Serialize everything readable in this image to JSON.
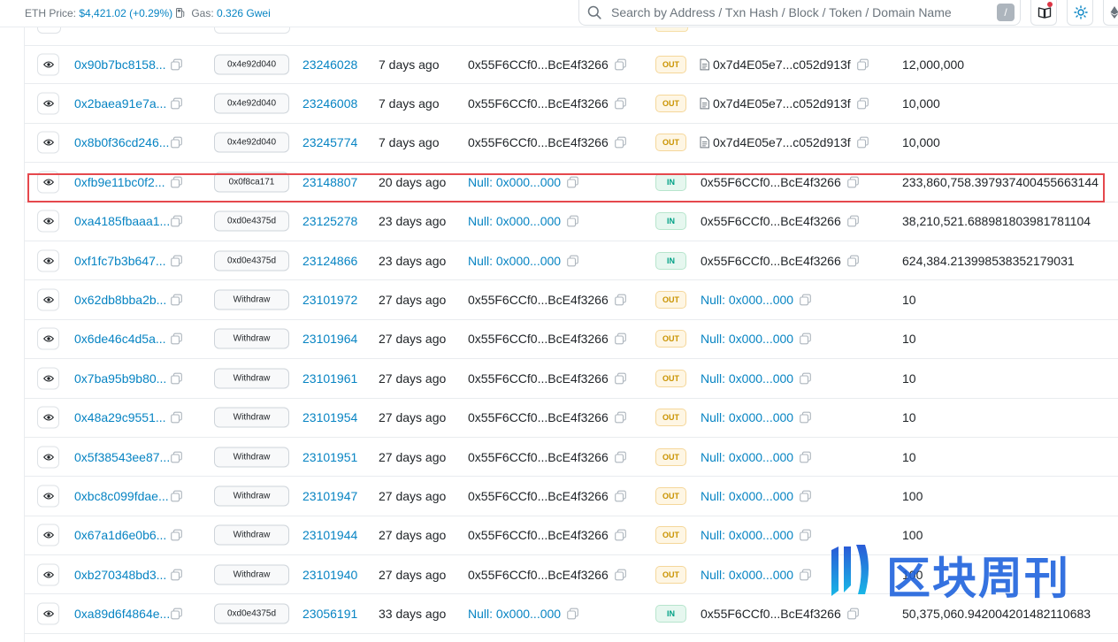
{
  "header": {
    "eth_price_label": "ETH Price:",
    "eth_price_value": "$4,421.02 (+0.29%)",
    "gas_label": "Gas:",
    "gas_value": "0.326 Gwei",
    "search_placeholder": "Search by Address / Txn Hash / Block / Token / Domain Name",
    "search_shortcut": "/"
  },
  "colors": {
    "link": "#0784c3",
    "highlight": "#e5484d",
    "out_badge": "#c99300",
    "in_badge": "#00a186"
  },
  "rows": [
    {
      "hash": "0x90b7bc8158...",
      "method": "0x4e92d040",
      "block": "23246028",
      "age": "7 days ago",
      "from": "0x55F6CCf0...BcE4f3266",
      "direction": "OUT",
      "to": "0x7d4E05e7...c052d913f",
      "amount": "12,000,000"
    },
    {
      "hash": "0x2baea91e7a...",
      "method": "0x4e92d040",
      "block": "23246008",
      "age": "7 days ago",
      "from": "0x55F6CCf0...BcE4f3266",
      "direction": "OUT",
      "to": "0x7d4E05e7...c052d913f",
      "amount": "10,000"
    },
    {
      "hash": "0x8b0f36cd246...",
      "method": "0x4e92d040",
      "block": "23245774",
      "age": "7 days ago",
      "from": "0x55F6CCf0...BcE4f3266",
      "direction": "OUT",
      "to": "0x7d4E05e7...c052d913f",
      "amount": "10,000"
    },
    {
      "hash": "0xfb9e11bc0f2...",
      "method": "0x0f8ca171",
      "block": "23148807",
      "age": "20 days ago",
      "from": "Null: 0x000...000",
      "direction": "IN",
      "to": "0x55F6CCf0...BcE4f3266",
      "amount": "233,860,758.397937400455663144"
    },
    {
      "hash": "0xa4185fbaaa1...",
      "method": "0xd0e4375d",
      "block": "23125278",
      "age": "23 days ago",
      "from": "Null: 0x000...000",
      "direction": "IN",
      "to": "0x55F6CCf0...BcE4f3266",
      "amount": "38,210,521.688981803981781104"
    },
    {
      "hash": "0xf1fc7b3b647...",
      "method": "0xd0e4375d",
      "block": "23124866",
      "age": "23 days ago",
      "from": "Null: 0x000...000",
      "direction": "IN",
      "to": "0x55F6CCf0...BcE4f3266",
      "amount": "624,384.213998538352179031"
    },
    {
      "hash": "0x62db8bba2b...",
      "method": "Withdraw",
      "block": "23101972",
      "age": "27 days ago",
      "from": "0x55F6CCf0...BcE4f3266",
      "direction": "OUT",
      "to": "Null: 0x000...000",
      "amount": "10"
    },
    {
      "hash": "0x6de46c4d5a...",
      "method": "Withdraw",
      "block": "23101964",
      "age": "27 days ago",
      "from": "0x55F6CCf0...BcE4f3266",
      "direction": "OUT",
      "to": "Null: 0x000...000",
      "amount": "10"
    },
    {
      "hash": "0x7ba95b9b80...",
      "method": "Withdraw",
      "block": "23101961",
      "age": "27 days ago",
      "from": "0x55F6CCf0...BcE4f3266",
      "direction": "OUT",
      "to": "Null: 0x000...000",
      "amount": "10"
    },
    {
      "hash": "0x48a29c9551...",
      "method": "Withdraw",
      "block": "23101954",
      "age": "27 days ago",
      "from": "0x55F6CCf0...BcE4f3266",
      "direction": "OUT",
      "to": "Null: 0x000...000",
      "amount": "10"
    },
    {
      "hash": "0x5f38543ee87...",
      "method": "Withdraw",
      "block": "23101951",
      "age": "27 days ago",
      "from": "0x55F6CCf0...BcE4f3266",
      "direction": "OUT",
      "to": "Null: 0x000...000",
      "amount": "10"
    },
    {
      "hash": "0xbc8c099fdae...",
      "method": "Withdraw",
      "block": "23101947",
      "age": "27 days ago",
      "from": "0x55F6CCf0...BcE4f3266",
      "direction": "OUT",
      "to": "Null: 0x000...000",
      "amount": "100"
    },
    {
      "hash": "0x67a1d6e0b6...",
      "method": "Withdraw",
      "block": "23101944",
      "age": "27 days ago",
      "from": "0x55F6CCf0...BcE4f3266",
      "direction": "OUT",
      "to": "Null: 0x000...000",
      "amount": "100"
    },
    {
      "hash": "0xb270348bd3...",
      "method": "Withdraw",
      "block": "23101940",
      "age": "27 days ago",
      "from": "0x55F6CCf0...BcE4f3266",
      "direction": "OUT",
      "to": "Null: 0x000...000",
      "amount": "100"
    },
    {
      "hash": "0xa89d6f4864e...",
      "method": "0xd0e4375d",
      "block": "23056191",
      "age": "33 days ago",
      "from": "Null: 0x000...000",
      "direction": "IN",
      "to": "0x55F6CCf0...BcE4f3266",
      "amount": "50,375,060.942004201482110683"
    }
  ],
  "watermark": {
    "text": "区块周刊"
  }
}
